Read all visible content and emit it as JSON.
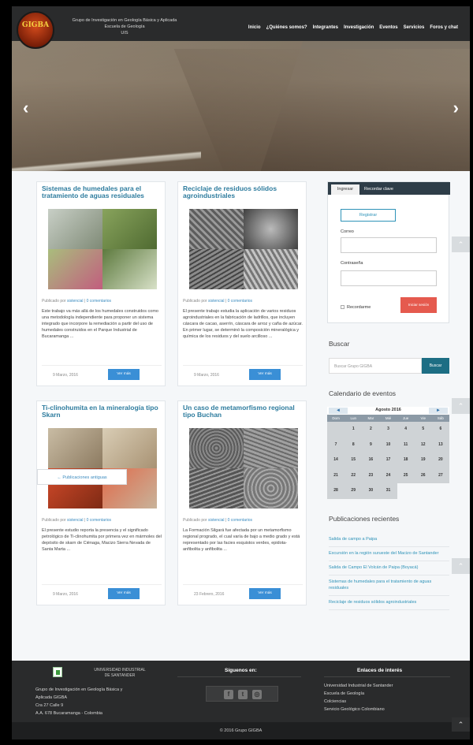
{
  "header": {
    "logo_text": "GIGBA",
    "org_lines": [
      "Grupo de Investigación en Geología Básica y Aplicada",
      "Escuela de Geología",
      "UIS"
    ],
    "nav": [
      "Inicio",
      "¿Quiénes somos?",
      "Integrantes",
      "Investigación",
      "Eventos",
      "Servicios",
      "Foros y chat"
    ]
  },
  "hero": {
    "prev": "‹",
    "next": "›"
  },
  "posts": [
    {
      "title": "Sistemas de humedales para el tratamiento de aguas residuales",
      "meta_prefix": "Publicado por",
      "author": "sistencial",
      "comments": "0 comentarios",
      "excerpt": "Este trabajo va más allá de los humedales construidos como una metodología independiente para proponer un sistema integrado que incorpore la remediación a partir del uso de humedales construidos en el Parque Industrial de Bucaramanga ...",
      "date": "9 Marzo, 2016",
      "more": "Ver más"
    },
    {
      "title": "Reciclaje de residuos sólidos agroindustriales",
      "meta_prefix": "Publicado por",
      "author": "sistencial",
      "comments": "0 comentarios",
      "excerpt": "El presente trabajo estudia la aplicación de varios residuos agroindustriales en la fabricación de ladrillos, que incluyen cáscara de cacao, aserrín, cáscara de arroz y caña de azúcar. En primer lugar, se determinó la composición mineralógica y química de los residuos y del suelo arcilloso ...",
      "date": "9 Marzo, 2016",
      "more": "Ver más"
    },
    {
      "title": "Ti-clinohumita en la mineralogía tipo Skarn",
      "meta_prefix": "Publicado por",
      "author": "sistencial",
      "comments": "0 comentarios",
      "excerpt": "El presente estudio reporta la presencia y el significado petrológico de Ti-clinohumita por primera vez en mármoles del depósito de skarn de Ciénaga, Macizo Sierra Nevada de Santa Marta ...",
      "date": "9 Marzo, 2016",
      "more": "Ver más"
    },
    {
      "title": "Un caso de metamorfismo regional tipo Buchan",
      "meta_prefix": "Publicado por",
      "author": "sistencial",
      "comments": "0 comentarios",
      "excerpt": "La Formación Silgará fue afectada por un metamorfismo regional progrado, el cual varía de bajo a medio grado y está representado por las facies esquistos verdes, epidota-anfibolita y anfibolita ...",
      "date": "23 Febrero, 2016",
      "more": "Ver más"
    }
  ],
  "older_posts": "← Publicaciones antiguas",
  "login": {
    "tab_login": "Ingresar",
    "tab_recover": "Recordar clave",
    "register": "Registrar",
    "email_label": "Correo",
    "password_label": "Contraseña",
    "remember": "Recordarme",
    "submit": "Iniciar sesión"
  },
  "search": {
    "heading": "Buscar",
    "placeholder": "Buscar Grupo GIGBA",
    "button": "Buscar"
  },
  "calendar": {
    "heading": "Calendario de eventos",
    "month": "Agosto 2016",
    "prev": "◄",
    "next": "►",
    "days": [
      "Dom",
      "Lun",
      "Mar",
      "Mié",
      "Jue",
      "Vie",
      "Sáb"
    ],
    "weeks": [
      [
        "",
        "1",
        "2",
        "3",
        "4",
        "5",
        "6"
      ],
      [
        "7",
        "8",
        "9",
        "10",
        "11",
        "12",
        "13"
      ],
      [
        "14",
        "15",
        "16",
        "17",
        "18",
        "19",
        "20"
      ],
      [
        "21",
        "22",
        "23",
        "24",
        "25",
        "26",
        "27"
      ],
      [
        "28",
        "29",
        "30",
        "31",
        "",
        "",
        ""
      ]
    ]
  },
  "recent": {
    "heading": "Publicaciones recientes",
    "items": [
      "Salida de campo a Paipa",
      "Excursión en la región surueste del Macizo de Santander",
      "Salida de Campo El Volcán de Paipa (Boyacá)",
      "Sistemas de humedales para el tratamiento de aguas residuales",
      "Reciclaje de residuos sólidos agroindustriales"
    ]
  },
  "footer": {
    "uis_lines": [
      "UNIVERSIDAD INDUSTRIAL",
      "DE SANTANDER"
    ],
    "address": [
      "Grupo de Investigación en Geología Básica y",
      "Aplicada GIGBA",
      "Cra 27 Calle 9",
      "A.A. 678 Bucaramanga - Colombia"
    ],
    "follow_heading": "Síguenos en:",
    "social": [
      "f",
      "t",
      "◎"
    ],
    "links_heading": "Enlaces de interés",
    "links": [
      "Universidad Industrial de Santander",
      "Escuela de Geología",
      "Colciencias",
      "Servicio Geológico Colombiano"
    ],
    "copyright": "© 2016 Grupo GIGBA"
  },
  "scroll_up": "⌃"
}
